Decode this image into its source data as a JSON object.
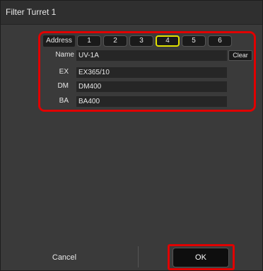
{
  "window": {
    "title": "Filter Turret 1"
  },
  "address": {
    "label": "Address",
    "options": [
      "1",
      "2",
      "3",
      "4",
      "5",
      "6"
    ],
    "selected": "4"
  },
  "fields": {
    "name": {
      "label": "Name",
      "value": "UV-1A"
    },
    "ex": {
      "label": "EX",
      "value": "EX365/10"
    },
    "dm": {
      "label": "DM",
      "value": "DM400"
    },
    "ba": {
      "label": "BA",
      "value": "BA400"
    }
  },
  "buttons": {
    "clear": "Clear",
    "cancel": "Cancel",
    "ok": "OK"
  },
  "colors": {
    "highlight": "#e00000",
    "selected_outline": "#e2e200",
    "background": "#3a3a3a"
  }
}
